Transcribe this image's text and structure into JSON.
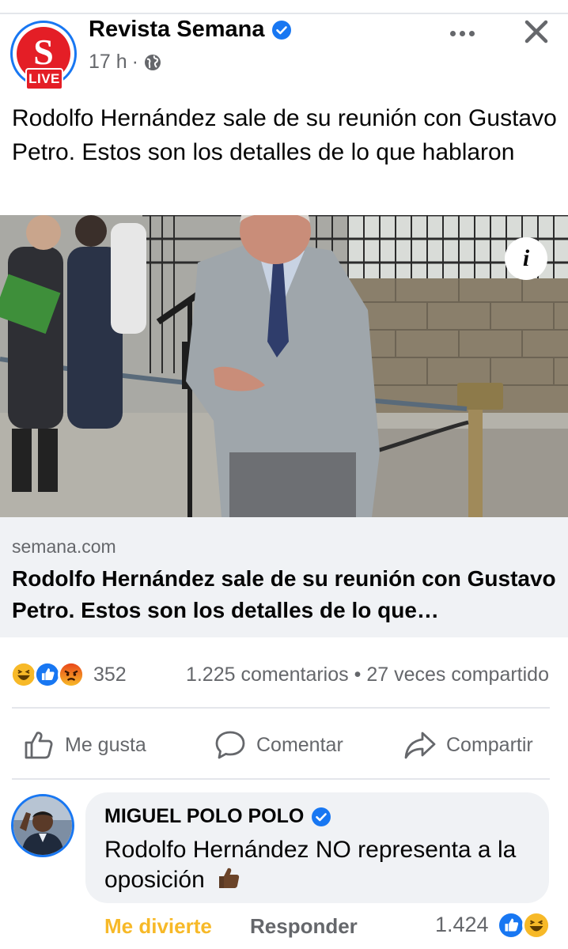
{
  "post": {
    "page_name": "Revista Semana",
    "time": "17 h",
    "meta_sep": "·",
    "badge": "LIVE",
    "logo_letter": "S",
    "text": "Rodolfo Hernández sale de su reunión con Gustavo Petro. Estos son los detalles de lo que hablaron"
  },
  "icons": {
    "verified": "verified-badge-icon",
    "globe": "globe-icon",
    "more": "more-options-icon",
    "close": "close-icon",
    "info": "info-icon",
    "like": "thumbs-up-icon",
    "comment": "speech-bubble-icon",
    "share": "share-arrow-icon"
  },
  "image": {
    "info_glyph": "i"
  },
  "link": {
    "domain": "semana.com",
    "title": "Rodolfo Hernández sale de su reunión con Gustavo Petro. Estos son los detalles de lo que…"
  },
  "reactions": {
    "count": "352",
    "comments": "1.225 comentarios",
    "sep": "•",
    "shares": "27 veces compartido",
    "types": [
      "haha",
      "like",
      "angry"
    ]
  },
  "actions": {
    "like": "Me gusta",
    "comment": "Comentar",
    "share": "Compartir"
  },
  "comment": {
    "author": "MIGUEL POLO POLO",
    "text": "Rodolfo Hernández NO representa a la oposición",
    "reaction_label": "Me divierte",
    "reply_label": "Responder",
    "reaction_count": "1.424"
  },
  "colors": {
    "facebook_blue": "#1877f2",
    "semana_red": "#e41e26",
    "secondary_text": "#65676b",
    "haha_yellow": "#f7b928",
    "link_bg": "#f0f2f5"
  }
}
